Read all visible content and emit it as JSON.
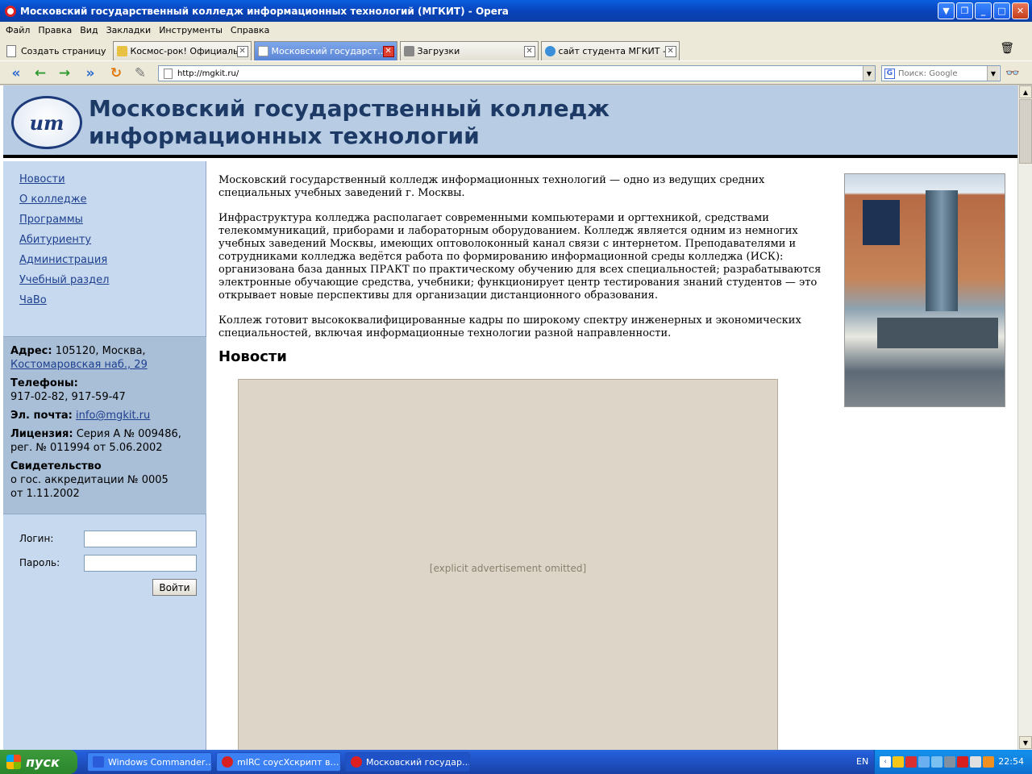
{
  "window": {
    "title": "Московский государственный колледж информационных технологий (МГКИТ) - Opera"
  },
  "menu": [
    "Файл",
    "Правка",
    "Вид",
    "Закладки",
    "Инструменты",
    "Справка"
  ],
  "tabs": {
    "new_page": "Создать страницу",
    "items": [
      {
        "label": "Космос-рок! Официаль…",
        "active": false,
        "icon_color": "#e8c042"
      },
      {
        "label": "Московский государст…",
        "active": true,
        "icon_color": "#ffffff"
      },
      {
        "label": "Загрузки",
        "active": false,
        "icon_color": "#888888"
      },
      {
        "label": "сайт студента МГКИТ -…",
        "active": false,
        "icon_color": "#3a8fd8"
      }
    ]
  },
  "address_bar": {
    "url": "http://mgkit.ru/"
  },
  "search": {
    "placeholder": "Поиск: Google"
  },
  "site": {
    "title": "Московский государственный колледж\nинформационных технологий",
    "logo_text": "ит",
    "nav": [
      "Новости",
      "О колледже",
      "Программы",
      "Абитуриенту",
      "Администрация",
      "Учебный раздел",
      "ЧаВо"
    ],
    "contacts": {
      "address_label": "Адрес:",
      "address_city": "105120, Москва,",
      "address_street": "Костомаровская наб., 29",
      "phones_label": "Телефоны:",
      "phones": "917-02-82, 917-59-47",
      "email_label": "Эл. почта:",
      "email": "info@mgkit.ru",
      "license_label": "Лицензия:",
      "license_a": "Серия А № 009486,",
      "license_b": "рег. № 011994 от 5.06.2002",
      "cert_label": "Свидетельство",
      "cert_a": "о гос. аккредитации № 0005",
      "cert_b": "от 1.11.2002"
    },
    "login": {
      "login_label": "Логин:",
      "password_label": "Пароль:",
      "submit": "Войти"
    },
    "paragraphs": [
      "Московский государственный колледж информационных технологий — одно из ведущих средних специальных учебных заведений г. Москвы.",
      "Инфраструктура колледжа располагает современными компьютерами и оргтехникой, средствами телекоммуникаций, приборами и лабораторным оборудованием. Колледж является одним из немногих учебных заведений Москвы, имеющих оптоволоконный канал связи с интернетом. Преподавателями и сотрудниками колледжа ведётся работа по формированию информационной среды колледжа (ИСК): организована база данных ПРАКТ по практическому обучению для всех специальностей; разрабатываются электронные обучающие средства, учебники; функционирует центр тестирования знаний студентов — это открывает новые перспективы для организации дистанционного образования.",
      "Коллеж готовит высококвалифицированные кадры по широкому спектру инженерных и экономических специальностей, включая информационные технологии разной направленности."
    ],
    "news_heading": "Новости"
  },
  "taskbar": {
    "start": "пуск",
    "tasks": [
      {
        "label": "Windows Commander…",
        "icon_color": "#2a5bd8"
      },
      {
        "label": "mIRC соусХскрипт в…",
        "icon_color": "#d82020"
      },
      {
        "label": "Московский государ…",
        "icon_color": "#e02020"
      }
    ],
    "lang": "EN",
    "clock": "22:54"
  }
}
